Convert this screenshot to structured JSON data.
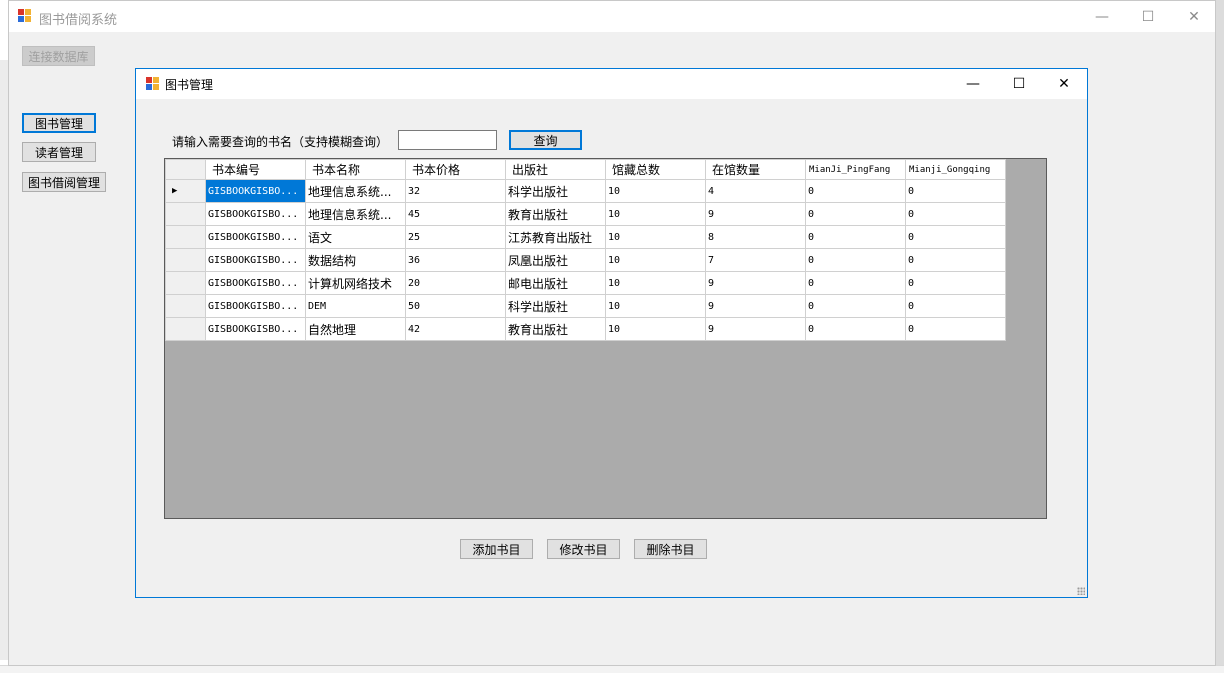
{
  "app": {
    "title": "图书借阅系统",
    "controls": {
      "minimize": "—",
      "maximize": "☐",
      "close": "✕"
    }
  },
  "sidebar": {
    "connect_db": "连接数据库",
    "book_mgmt": "图书管理",
    "reader_mgmt": "读者管理",
    "borrow_mgmt": "图书借阅管理"
  },
  "child": {
    "title": "图书管理",
    "controls": {
      "minimize": "—",
      "maximize": "☐",
      "close": "✕"
    },
    "search_label": "请输入需要查询的书名（支持模糊查询）",
    "search_value": "",
    "query_button": "查询",
    "grid": {
      "columns": [
        "书本编号",
        "书本名称",
        "书本价格",
        "出版社",
        "馆藏总数",
        "在馆数量",
        "MianJi_PingFang",
        "Mianji_Gongqing"
      ],
      "rows": [
        [
          "GISBOOKGISBO...",
          "地理信息系统...",
          "32",
          "科学出版社",
          "10",
          "4",
          "0",
          "0"
        ],
        [
          "GISBOOKGISBO...",
          "地理信息系统...",
          "45",
          "教育出版社",
          "10",
          "9",
          "0",
          "0"
        ],
        [
          "GISBOOKGISBO...",
          "语文",
          "25",
          "江苏教育出版社",
          "10",
          "8",
          "0",
          "0"
        ],
        [
          "GISBOOKGISBO...",
          "数据结构",
          "36",
          "凤凰出版社",
          "10",
          "7",
          "0",
          "0"
        ],
        [
          "GISBOOKGISBO...",
          "计算机网络技术",
          "20",
          "邮电出版社",
          "10",
          "9",
          "0",
          "0"
        ],
        [
          "GISBOOKGISBO...",
          "DEM",
          "50",
          "科学出版社",
          "10",
          "9",
          "0",
          "0"
        ],
        [
          "GISBOOKGISBO...",
          "自然地理",
          "42",
          "教育出版社",
          "10",
          "9",
          "0",
          "0"
        ]
      ],
      "current_row_marker": "▶"
    },
    "actions": {
      "add": "添加书目",
      "edit": "修改书目",
      "delete": "删除书目"
    }
  },
  "colors": {
    "accent": "#0078d7",
    "window_bg": "#f0f0f0",
    "grid_empty": "#ababab"
  }
}
